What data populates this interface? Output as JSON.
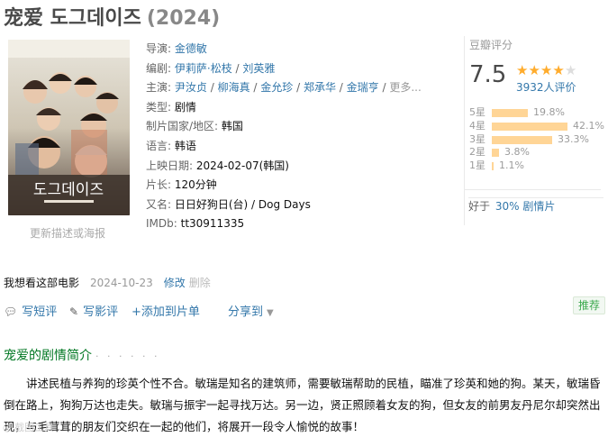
{
  "header": {
    "title": "宠爱 도그데이즈",
    "year": "(2024)"
  },
  "poster": {
    "title_text": "도그데이즈",
    "update_link": "更新描述或海报"
  },
  "info": {
    "director_label": "导演",
    "director": "金德敏",
    "writer_label": "编剧",
    "writers": [
      "伊莉萨·松枝",
      "刘英雅"
    ],
    "cast_label": "主演",
    "cast": [
      "尹汝贞",
      "柳海真",
      "金允珍",
      "郑承华",
      "金瑞亨"
    ],
    "cast_more": "更多...",
    "genre_label": "类型",
    "genre": "剧情",
    "country_label": "制片国家/地区",
    "country": "韩国",
    "language_label": "语言",
    "language": "韩语",
    "release_label": "上映日期",
    "release": "2024-02-07(韩国)",
    "runtime_label": "片长",
    "runtime": "120分钟",
    "aka_label": "又名",
    "aka": "日日好狗日(台) / Dog Days",
    "imdb_label": "IMDb",
    "imdb": "tt30911335"
  },
  "rating": {
    "label": "豆瓣评分",
    "score": "7.5",
    "stars_filled": 4,
    "stars_total": 5,
    "votes": "3932人评价",
    "distribution": [
      {
        "star": "5星",
        "pct": "19.8%",
        "value": 19.8
      },
      {
        "star": "4星",
        "pct": "42.1%",
        "value": 42.1
      },
      {
        "star": "3星",
        "pct": "33.3%",
        "value": 33.3
      },
      {
        "star": "2星",
        "pct": "3.8%",
        "value": 3.8
      },
      {
        "star": "1星",
        "pct": "1.1%",
        "value": 1.1
      }
    ],
    "better_than_prefix": "好于",
    "better_than_link": "30% 剧情片"
  },
  "interest": {
    "status": "我想看这部电影",
    "date": "2024-10-23",
    "edit": "修改",
    "delete": "删除"
  },
  "actions": {
    "short_review": "写短评",
    "review": "写影评",
    "add_to_list": "+添加到片单",
    "share": "分享到",
    "recommend": "推荐"
  },
  "intro": {
    "title": "宠爱的剧情简介",
    "dots": "· · · · · ·",
    "text": "讲述民植与养狗的珍英个性不合。敏瑞是知名的建筑师，需要敏瑞帮助的民植，瞄准了珍英和她的狗。某天，敏瑞昏倒在路上，狗狗万达也走失。敏瑞与振宇一起寻找万达。另一边，贤正照顾着女友的狗，但女友的前男友丹尼尔却突然出现，与毛茸茸的朋友们交织在一起的他们，将展开一段令人愉悦的故事！"
  },
  "colors": {
    "link": "#3377aa",
    "star": "#ffac2d",
    "bar": "#ffd596",
    "section_green": "#007722"
  }
}
